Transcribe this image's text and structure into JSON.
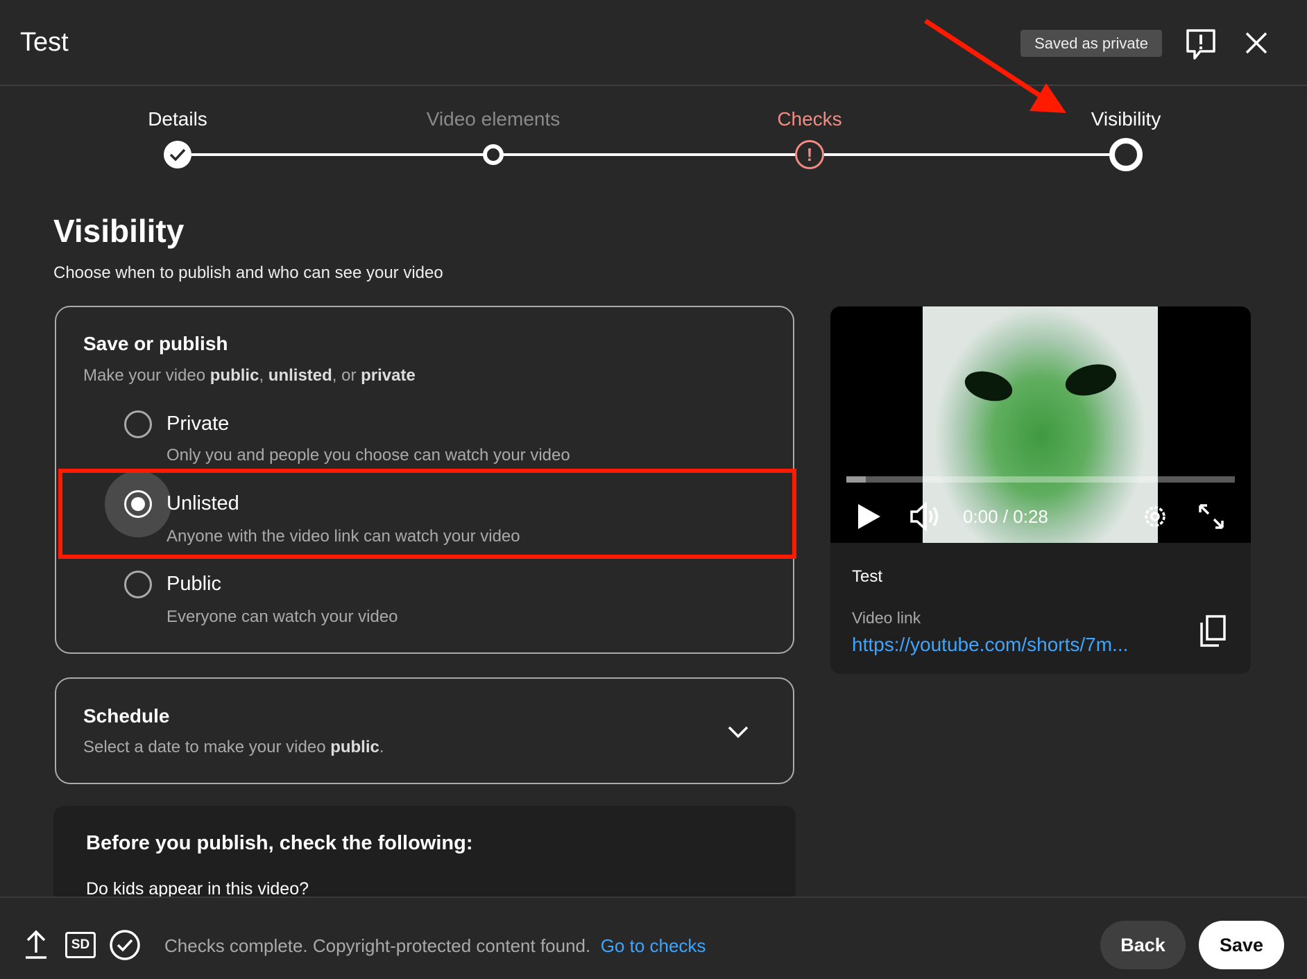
{
  "header": {
    "title": "Test",
    "saved_badge": "Saved as private",
    "feedback_icon": "feedback-icon",
    "close_icon": "close-icon"
  },
  "stepper": {
    "steps": [
      {
        "label": "Details",
        "state": "done"
      },
      {
        "label": "Video elements",
        "state": "todo"
      },
      {
        "label": "Checks",
        "state": "warning"
      },
      {
        "label": "Visibility",
        "state": "current"
      }
    ]
  },
  "main": {
    "title": "Visibility",
    "subtitle": "Choose when to publish and who can see your video"
  },
  "save_publish": {
    "title": "Save or publish",
    "sub_prefix": "Make your video ",
    "public": "public",
    "comma": ", ",
    "unlisted": "unlisted",
    "or": ", or ",
    "private": "private",
    "options": [
      {
        "label": "Private",
        "desc": "Only you and people you choose can watch your video",
        "selected": false
      },
      {
        "label": "Unlisted",
        "desc": "Anyone with the video link can watch your video",
        "selected": true
      },
      {
        "label": "Public",
        "desc": "Everyone can watch your video",
        "selected": false
      }
    ]
  },
  "schedule": {
    "title": "Schedule",
    "sub_prefix": "Select a date to make your video ",
    "sub_bold": "public",
    "sub_suffix": "."
  },
  "before_publish": {
    "title": "Before you publish, check the following:",
    "question": "Do kids appear in this video?"
  },
  "video": {
    "time": "0:00 / 0:28",
    "progress": 0.05,
    "title": "Test",
    "link_label": "Video link",
    "link": "https://youtube.com/shorts/7m..."
  },
  "footer": {
    "status": "Checks complete. Copyright-protected content found.",
    "checks_link": "Go to checks",
    "back": "Back",
    "save": "Save",
    "sd": "SD"
  },
  "colors": {
    "accent_link": "#3ea6ff",
    "warning": "#f28b82",
    "annotation": "#ff1a00"
  }
}
